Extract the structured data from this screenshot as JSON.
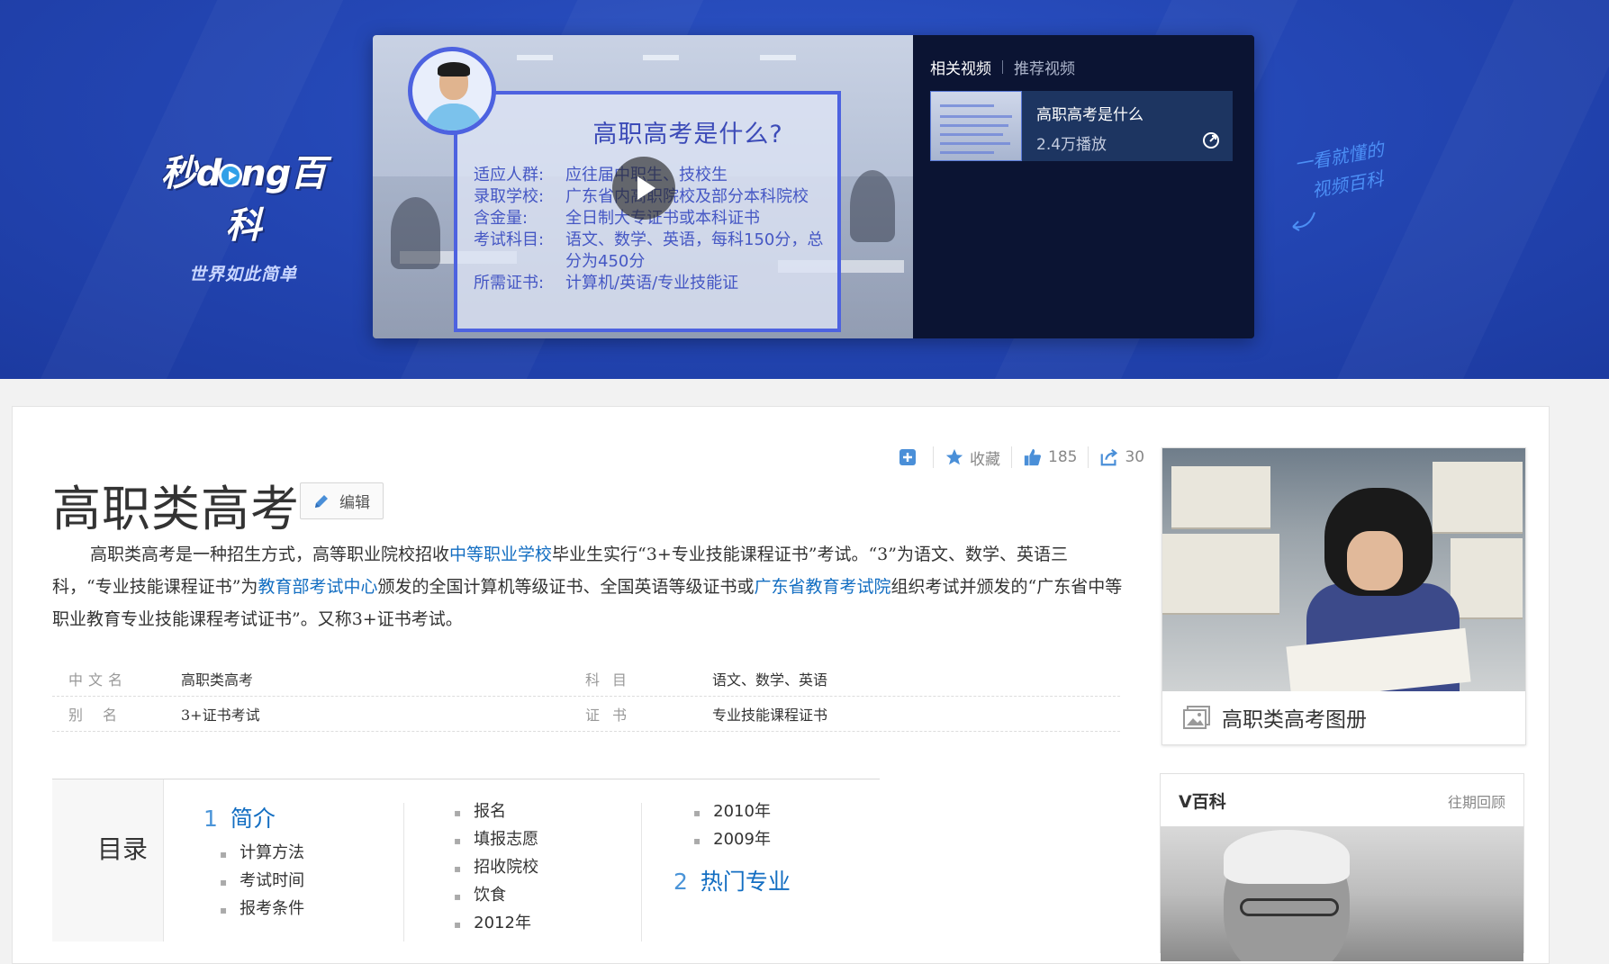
{
  "banner": {
    "logo_text_1": "秒",
    "logo_text_2": "d",
    "logo_text_3": "ng百科",
    "slogan": "世界如此简单",
    "hand_note_1": "一看就懂的",
    "hand_note_2": "视频百科",
    "video": {
      "title": "高职高考是什么?",
      "lines": [
        {
          "k": "适应人群:",
          "v": "应往届中职生、技校生"
        },
        {
          "k": "录取学校:",
          "v": "广东省内高职院校及部分本科院校"
        },
        {
          "k": "含金量:",
          "v": "全日制大专证书或本科证书"
        },
        {
          "k": "考试科目:",
          "v": "语文、数学、英语，每科150分，总分为450分"
        },
        {
          "k": "所需证书:",
          "v": "计算机/英语/专业技能证"
        }
      ]
    },
    "side": {
      "tab_active": "相关视频",
      "tab_other": "推荐视频",
      "related": {
        "title": "高职高考是什么",
        "plays": "2.4万播放"
      }
    }
  },
  "actions": {
    "favorite": "收藏",
    "likes": "185",
    "shares": "30"
  },
  "article": {
    "title": "高职类高考",
    "edit_label": "编辑",
    "summary": {
      "p1": "高职类高考是一种招生方式，高等职业院校招收",
      "link1": "中等职业学校",
      "p2": "毕业生实行“3+专业技能课程证书”考试。“3”为语文、数学、英语三科，“专业技能课程证书”为",
      "link2": "教育部考试中心",
      "p3": "颁发的全国计算机等级证书、全国英语等级证书或",
      "link3": "广东省教育考试院",
      "p4": "组织考试并颁发的“广东省中等职业教育专业技能课程考试证书”。又称3+证书考试。"
    },
    "basic_info": [
      {
        "k1": "中文名",
        "v1": "高职类高考",
        "k2": "科目",
        "v2": "语文、数学、英语"
      },
      {
        "k1": "别名",
        "v1": "3+证书考试",
        "k2": "证书",
        "v2": "专业技能课程证书"
      }
    ]
  },
  "catalog": {
    "label": "目录",
    "col1": {
      "num": "1",
      "title": "简介",
      "items": [
        "计算方法",
        "考试时间",
        "报考条件"
      ]
    },
    "col2": {
      "items": [
        "报名",
        "填报志愿",
        "招收院校",
        "饮食",
        "2012年"
      ]
    },
    "col3": {
      "items": [
        "2010年",
        "2009年"
      ],
      "num": "2",
      "title": "热门专业"
    }
  },
  "sidebar": {
    "album_caption": "高职类高考图册",
    "vbaike_title": "V百科",
    "vbaike_more": "往期回顾"
  }
}
